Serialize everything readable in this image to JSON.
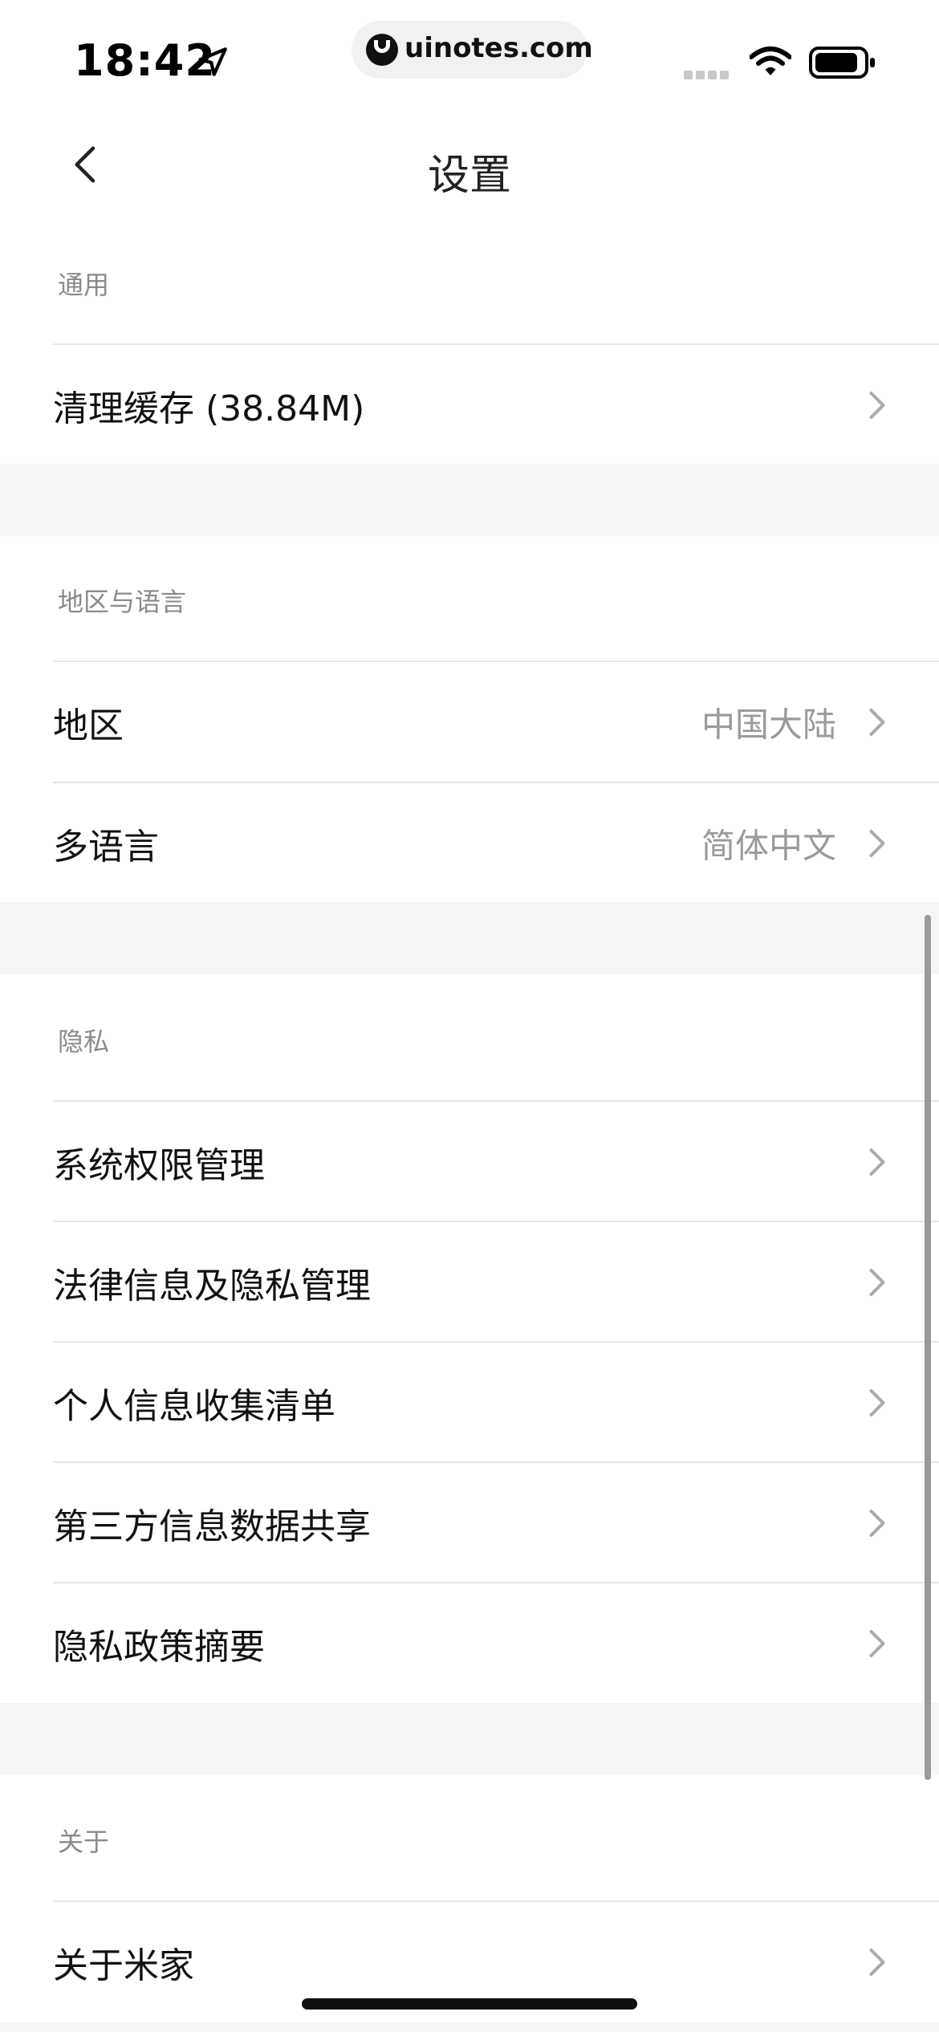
{
  "status_bar": {
    "time": "18:42",
    "url": "uinotes.com",
    "icons": [
      "location-arrow-icon",
      "uinotes-logo-icon",
      "cellular-signal-icon",
      "wifi-icon",
      "battery-icon"
    ]
  },
  "nav": {
    "title": "设置",
    "back_icon": "chevron-left-icon"
  },
  "sections": {
    "general": {
      "header": "通用",
      "items": [
        {
          "label": "清理缓存 (38.84M)",
          "value": ""
        }
      ]
    },
    "region_language": {
      "header": "地区与语言",
      "items": [
        {
          "label": "地区",
          "value": "中国大陆"
        },
        {
          "label": "多语言",
          "value": "简体中文"
        }
      ]
    },
    "privacy": {
      "header": "隐私",
      "items": [
        {
          "label": "系统权限管理",
          "value": ""
        },
        {
          "label": "法律信息及隐私管理",
          "value": ""
        },
        {
          "label": "个人信息收集清单",
          "value": ""
        },
        {
          "label": "第三方信息数据共享",
          "value": ""
        },
        {
          "label": "隐私政策摘要",
          "value": ""
        }
      ]
    },
    "about": {
      "header": "关于",
      "items": [
        {
          "label": "关于米家",
          "value": ""
        }
      ]
    }
  },
  "colors": {
    "text_primary": "#111111",
    "text_secondary": "#8a8a8a",
    "value_text": "#9a9a9a",
    "separator": "#e6e6e6",
    "section_gap": "#f5f5f5",
    "background": "#ffffff"
  }
}
